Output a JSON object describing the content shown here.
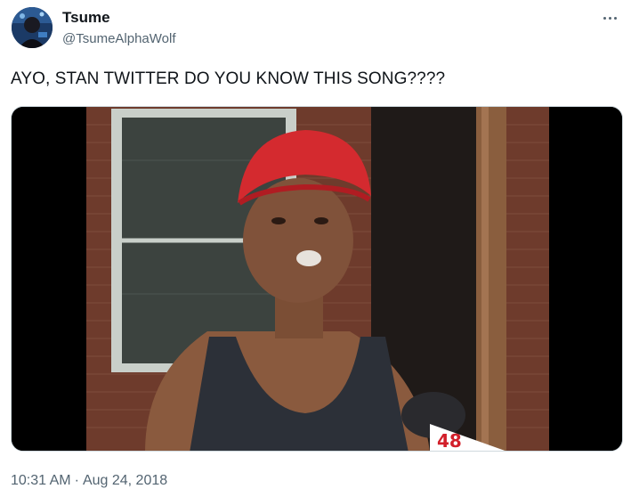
{
  "tweet": {
    "author": {
      "display_name": "Tsume",
      "handle": "@TsumeAlphaWolf",
      "avatar_icon": "user-avatar"
    },
    "more_icon": "more-horizontal-icon",
    "text": "AYO, STAN TWITTER DO YOU KNOW THIS SONG????",
    "media": {
      "type": "video-still",
      "caption_overlay": "48"
    },
    "time": "10:31 AM",
    "separator": "·",
    "date": "Aug 24, 2018"
  },
  "colors": {
    "text_primary": "#0f1419",
    "text_secondary": "#536471",
    "border": "#cfd9de"
  }
}
